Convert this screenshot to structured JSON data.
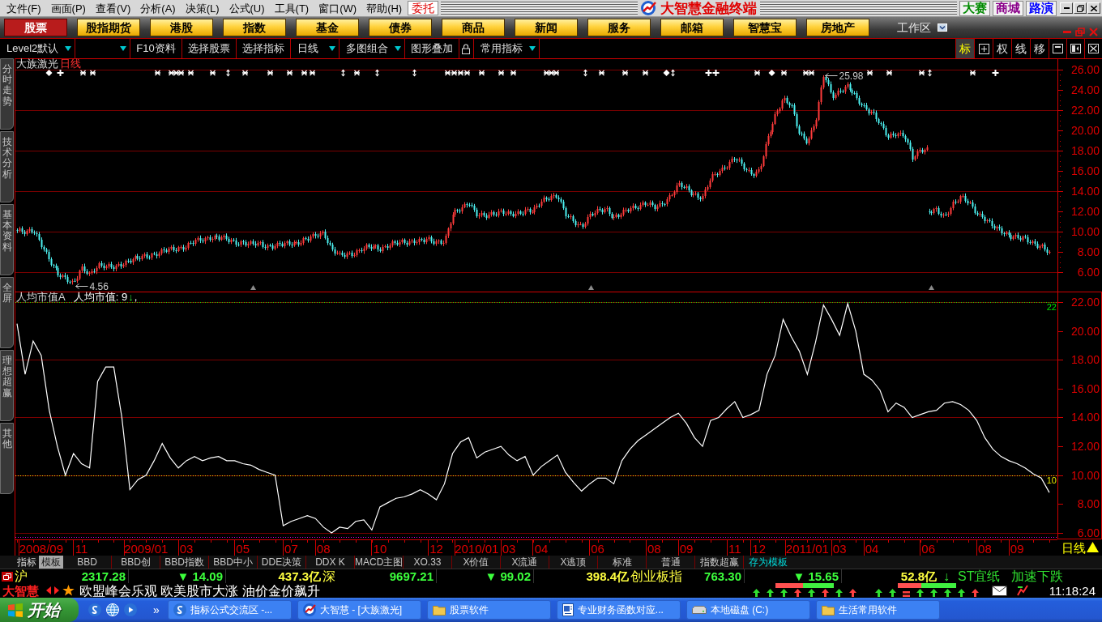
{
  "menu_bar": {
    "items": [
      "文件(F)",
      "画面(P)",
      "查看(V)",
      "分析(A)",
      "决策(L)",
      "公式(U)",
      "工具(T)",
      "窗口(W)",
      "帮助(H)"
    ],
    "order_button": "委托"
  },
  "title_bar": {
    "title": "大智慧金融终端",
    "links": [
      {
        "label": "大赛",
        "color": "#008a00"
      },
      {
        "label": "商城",
        "color": "#8a008a"
      },
      {
        "label": "路演",
        "color": "#0000ff"
      }
    ]
  },
  "nav": {
    "items": [
      {
        "label": "股票",
        "selected": true
      },
      {
        "label": "股指期货",
        "selected": false
      },
      {
        "label": "港股",
        "selected": false
      },
      {
        "label": "指数",
        "selected": false
      },
      {
        "label": "基金",
        "selected": false
      },
      {
        "label": "债券",
        "selected": false
      },
      {
        "label": "商品",
        "selected": false
      },
      {
        "label": "新闻",
        "selected": false
      },
      {
        "label": "服务",
        "selected": false
      },
      {
        "label": "邮箱",
        "selected": false
      },
      {
        "label": "智慧宝",
        "selected": false
      },
      {
        "label": "房地产",
        "selected": false
      }
    ],
    "workspace": "工作区"
  },
  "toolbar": {
    "items": [
      {
        "kind": "dropdown",
        "label": "Level2默认"
      },
      {
        "kind": "dropdown"
      },
      {
        "kind": "button",
        "label": "F10资料"
      },
      {
        "kind": "button",
        "label": "选择股票"
      },
      {
        "kind": "button",
        "label": "选择指标"
      },
      {
        "kind": "dropdown",
        "label": "日线"
      },
      {
        "kind": "dropdown",
        "label": "多图组合"
      },
      {
        "kind": "button",
        "label": "图形叠加"
      },
      {
        "kind": "lock"
      },
      {
        "kind": "dropdown",
        "label": "常用指标"
      }
    ]
  },
  "view_toggles": [
    {
      "label": "标",
      "selected": true
    },
    {
      "label": "权",
      "selected": false
    },
    {
      "label": "线",
      "selected": false
    },
    {
      "label": "移",
      "selected": false
    }
  ],
  "side_tabs": [
    "分时走势",
    "技术分析",
    "基本资料",
    "全屏",
    "理想超赢",
    "其他"
  ],
  "price_chart": {
    "title": "大族激光",
    "period": "日线",
    "axis_labels": [
      "26.00",
      "24.00",
      "22.00",
      "20.00",
      "18.00",
      "16.00",
      "14.00",
      "12.00",
      "10.00",
      "8.00",
      "6.00"
    ],
    "high_label": "25.98",
    "low_label": "4.56"
  },
  "indicator_chart": {
    "name": "人均市值A",
    "reading": "人均市值: 9",
    "trend_arrow": "↓",
    "suffix": ",",
    "period_button": "日线",
    "chart_data": {
      "type": "line",
      "grid": true,
      "ylim": [
        5.55,
        22.73
      ],
      "yticks": [
        {
          "value": 22,
          "label": "22.00"
        },
        {
          "value": 20,
          "label": "20.00"
        },
        {
          "value": 18,
          "label": "18.00"
        },
        {
          "value": 16,
          "label": "16.00"
        },
        {
          "value": 14,
          "label": "14.00"
        },
        {
          "value": 12,
          "label": "12.00"
        },
        {
          "value": 10,
          "label": "10.00"
        },
        {
          "value": 8,
          "label": "8.00"
        },
        {
          "value": 6,
          "label": "6.00"
        }
      ],
      "categories": [
        null,
        null,
        null,
        "2008/09",
        null,
        null,
        null,
        null,
        "11",
        null,
        null,
        null,
        null,
        null,
        null,
        null,
        "2009/01",
        null,
        null,
        null,
        null,
        "03",
        null,
        null,
        null,
        null,
        null,
        null,
        "05",
        null,
        null,
        null,
        null,
        null,
        "07",
        null,
        null,
        null,
        "08",
        null,
        null,
        null,
        null,
        null,
        null,
        "10",
        null,
        null,
        null,
        null,
        null,
        null,
        "12",
        null,
        null,
        null,
        null,
        "2010/01",
        null,
        null,
        null,
        "03",
        null,
        null,
        null,
        "04",
        null,
        null,
        null,
        null,
        null,
        null,
        "06",
        null,
        null,
        null,
        null,
        null,
        null,
        "08",
        null,
        null,
        null,
        "09",
        null,
        null,
        null,
        null,
        null,
        "11",
        null,
        null,
        "12",
        null,
        null,
        null,
        null,
        null,
        "2011/01",
        null,
        null,
        null,
        "03",
        null,
        null,
        null,
        "04",
        null,
        null,
        null,
        null,
        null,
        null,
        "06",
        null,
        null,
        null,
        null,
        null,
        null,
        "08",
        null,
        null,
        null,
        "09",
        null,
        null,
        null,
        null
      ],
      "series": [
        {
          "color": "#ffffff",
          "values": [
            20.5,
            17.0,
            19.3,
            18.3,
            14.5,
            12.0,
            10.0,
            11.5,
            10.8,
            10.5,
            16.5,
            17.5,
            17.5,
            14.0,
            9.0,
            9.7,
            10.0,
            11.0,
            12.2,
            11.2,
            10.5,
            11.0,
            11.3,
            11.0,
            11.2,
            11.3,
            11.0,
            11.0,
            10.8,
            10.7,
            10.4,
            10.2,
            10.0,
            6.5,
            6.8,
            7.0,
            7.2,
            7.0,
            6.4,
            6.0,
            6.4,
            6.3,
            6.8,
            6.9,
            6.2,
            7.8,
            8.1,
            8.4,
            8.5,
            8.7,
            9.0,
            8.7,
            8.3,
            9.4,
            11.5,
            12.3,
            12.6,
            11.2,
            11.6,
            11.8,
            12.0,
            11.4,
            11.0,
            11.3,
            10.0,
            10.6,
            11.0,
            11.4,
            10.2,
            9.5,
            8.9,
            9.4,
            9.8,
            9.8,
            9.4,
            11.0,
            11.8,
            12.4,
            12.8,
            13.2,
            13.6,
            14.0,
            14.3,
            13.6,
            12.6,
            12.0,
            13.8,
            14.0,
            14.6,
            15.1,
            14.0,
            14.2,
            14.5,
            17.0,
            18.3,
            20.8,
            19.6,
            18.6,
            17.0,
            19.2,
            21.8,
            20.8,
            19.7,
            21.9,
            20.0,
            17.0,
            16.6,
            15.9,
            14.4,
            15.0,
            14.7,
            14.0,
            14.2,
            14.4,
            14.5,
            15.0,
            15.1,
            14.9,
            14.5,
            13.8,
            12.6,
            11.8,
            11.3,
            11.0,
            10.8,
            10.5,
            10.1,
            9.8,
            8.8
          ]
        }
      ],
      "ref_lines": [
        {
          "axis": "y",
          "value": 22,
          "label": "22",
          "color": "#00e000"
        },
        {
          "axis": "y",
          "value": 10,
          "label": "10",
          "color": "#e8e800"
        },
        {
          "axis": "y",
          "value": 5.7,
          "color": "#e000e0"
        }
      ]
    }
  },
  "indicator_tabs": {
    "modes": [
      {
        "label": "指标",
        "selected": false
      },
      {
        "label": "模板",
        "selected": true
      }
    ],
    "templates": [
      "BBD",
      "BBD创",
      "BBD指数",
      "BBD中小",
      "DDE决策",
      "DDX K",
      "MACD主图",
      "XO.33",
      "X价值",
      "X流通",
      "X逃顶",
      "标准",
      "普通",
      "指数超赢"
    ],
    "save_template": "存为模板"
  },
  "ticker": {
    "indices": [
      {
        "name": "沪",
        "value": "2317.28",
        "change": "▼ 14.09",
        "amount": "437.3亿"
      },
      {
        "name": "深",
        "value": "9697.21",
        "change": "▼ 99.02",
        "amount": "398.4亿"
      },
      {
        "name": "创业板指",
        "value": "763.30",
        "change": "▼ 15.65",
        "amount": "52.8亿"
      }
    ],
    "alert": {
      "arrow": "↓",
      "stock": "ST宜纸",
      "signal": "加速下跌"
    }
  },
  "news_bar": {
    "brand": "大智慧",
    "headline": "欧盟峰会乐观 欧美股市大涨 油价金价飙升",
    "breadth": [
      {
        "level": 0.48,
        "signals": [
          {
            "kind": "up",
            "color": "#30e030"
          },
          {
            "kind": "up",
            "color": "#30e030"
          },
          {
            "kind": "up",
            "color": "#30e030"
          },
          {
            "kind": "up",
            "color": "#ff4040"
          },
          {
            "kind": "up",
            "color": "#30e030"
          },
          {
            "kind": "up",
            "color": "#ff4040"
          },
          {
            "kind": "up",
            "color": "#30e030"
          },
          {
            "kind": "up",
            "color": "#ff4040"
          }
        ]
      },
      {
        "level": 0.4,
        "signals": [
          {
            "kind": "up",
            "color": "#30e030"
          },
          {
            "kind": "up",
            "color": "#30e030"
          },
          {
            "kind": "flat",
            "color": "#ff4040"
          },
          {
            "kind": "up",
            "color": "#30e030"
          },
          {
            "kind": "up",
            "color": "#30e030"
          },
          {
            "kind": "up",
            "color": "#30e030"
          },
          {
            "kind": "up",
            "color": "#30e030"
          },
          {
            "kind": "up",
            "color": "#ff4040"
          }
        ]
      }
    ],
    "time": "11:18:24"
  },
  "taskbar": {
    "start": "开始",
    "more": "»",
    "tasks": [
      {
        "kind": "browser",
        "label": "指标公式交流区 -..."
      },
      {
        "kind": "app",
        "label": "大智慧 - [大族激光]"
      },
      {
        "kind": "folder",
        "label": "股票软件"
      },
      {
        "kind": "document",
        "label": "专业财务函数对应..."
      },
      {
        "kind": "drive",
        "label": "本地磁盘 (C:)"
      },
      {
        "kind": "folder",
        "label": "生活常用软件"
      }
    ]
  }
}
